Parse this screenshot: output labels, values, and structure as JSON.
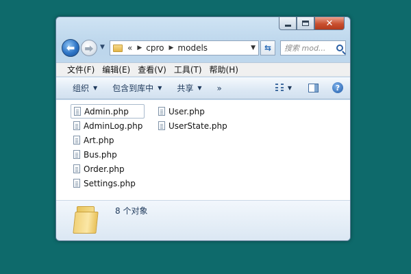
{
  "window": {
    "caption_buttons": {
      "close": "✕"
    }
  },
  "navigation": {
    "back_glyph": "⬅",
    "forward_glyph": "⮕",
    "breadcrumb_overflow": "«",
    "breadcrumb": [
      "cpro",
      "models"
    ],
    "search_placeholder": "搜索 mod..."
  },
  "menubar": {
    "items": [
      "文件(F)",
      "编辑(E)",
      "查看(V)",
      "工具(T)",
      "帮助(H)"
    ]
  },
  "toolbar": {
    "organize": "组织",
    "include_in_library": "包含到库中",
    "share": "共享",
    "more": "»",
    "help": "?"
  },
  "files": {
    "column1": [
      "Admin.php",
      "AdminLog.php",
      "Art.php",
      "Bus.php",
      "Order.php",
      "Settings.php"
    ],
    "column2": [
      "User.php",
      "UserState.php"
    ],
    "selected": "Admin.php"
  },
  "details": {
    "count_text": "8 个对象"
  },
  "icons": {
    "back": "back-arrow-icon",
    "forward": "forward-arrow-icon",
    "folder": "folder-icon",
    "refresh": "refresh-icon",
    "search": "search-icon",
    "views": "views-icon",
    "preview_pane": "preview-pane-icon",
    "help": "help-icon",
    "file": "php-file-icon"
  },
  "colors": {
    "desktop": "#0e6a6b",
    "window_frame": "#bcd6ec",
    "toolbar": "#dce8f4",
    "close_button": "#c9502f"
  }
}
